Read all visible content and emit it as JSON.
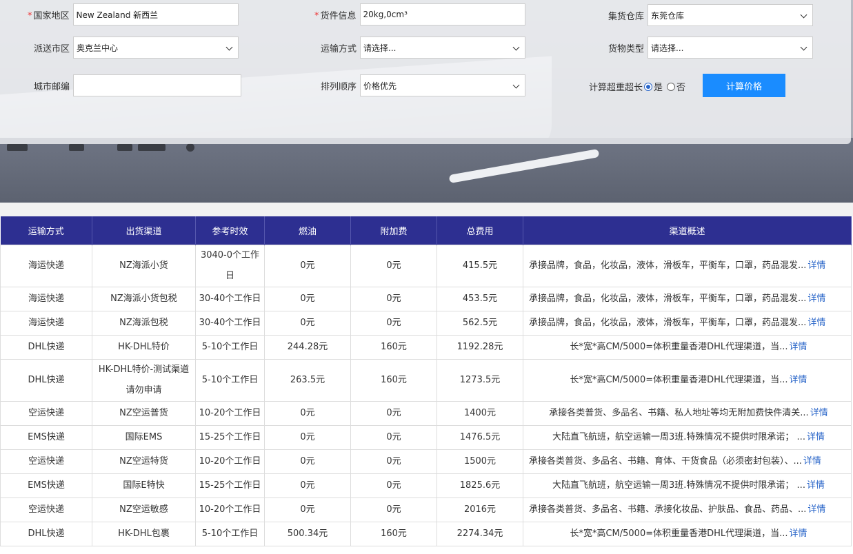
{
  "form": {
    "country": {
      "label": "国家地区",
      "value": "New Zealand 新西兰"
    },
    "cargo": {
      "label": "货件信息",
      "value": "20kg,0cm³"
    },
    "warehouse": {
      "label": "集货仓库",
      "value": "东莞仓库"
    },
    "district": {
      "label": "派送市区",
      "value": "奥克兰中心"
    },
    "shipping_method": {
      "label": "运输方式",
      "value": "请选择..."
    },
    "goods_type": {
      "label": "货物类型",
      "value": "请选择..."
    },
    "postcode": {
      "label": "城市邮编",
      "value": ""
    },
    "sort_order": {
      "label": "排列顺序",
      "value": "价格优先"
    },
    "overweight": {
      "label": "计算超重超长",
      "yes": "是",
      "no": "否",
      "selected": "是"
    },
    "calc_button": "计算价格"
  },
  "table": {
    "headers": [
      "运输方式",
      "出货渠道",
      "参考时效",
      "燃油",
      "附加费",
      "总费用",
      "渠道概述"
    ],
    "detail_label": "详情",
    "rows": [
      {
        "method": "海运快递",
        "channel": "NZ海派小货",
        "time": "3040-0个工作日",
        "fuel": "0元",
        "extra": "0元",
        "total": "415.5元",
        "desc": "承接品牌，食品，化妆品，液体，滑板车，平衡车，口罩，药品混发..."
      },
      {
        "method": "海运快递",
        "channel": "NZ海派小货包税",
        "time": "30-40个工作日",
        "fuel": "0元",
        "extra": "0元",
        "total": "453.5元",
        "desc": "承接品牌，食品，化妆品，液体，滑板车，平衡车，口罩，药品混发..."
      },
      {
        "method": "海运快递",
        "channel": "NZ海派包税",
        "time": "30-40个工作日",
        "fuel": "0元",
        "extra": "0元",
        "total": "562.5元",
        "desc": "承接品牌，食品，化妆品，液体，滑板车，平衡车，口罩，药品混发..."
      },
      {
        "method": "DHL快递",
        "channel": "HK-DHL特价",
        "time": "5-10个工作日",
        "fuel": "244.28元",
        "extra": "160元",
        "total": "1192.28元",
        "desc": "长*宽*高CM/5000=体积重量香港DHL代理渠道，当..."
      },
      {
        "method": "DHL快递",
        "channel": "HK-DHL特价-测试渠道请勿申请",
        "time": "5-10个工作日",
        "fuel": "263.5元",
        "extra": "160元",
        "total": "1273.5元",
        "desc": "长*宽*高CM/5000=体积重量香港DHL代理渠道，当..."
      },
      {
        "method": "空运快递",
        "channel": "NZ空运普货",
        "time": "10-20个工作日",
        "fuel": "0元",
        "extra": "0元",
        "total": "1400元",
        "desc": "承接各类普货、多品名、书籍、私人地址等均无附加费快件清关..."
      },
      {
        "method": "EMS快递",
        "channel": "国际EMS",
        "time": "15-25个工作日",
        "fuel": "0元",
        "extra": "0元",
        "total": "1476.5元",
        "desc": "大陆直飞航班，航空运输一周3班.特殊情况不提供时限承诺； ..."
      },
      {
        "method": "空运快递",
        "channel": "NZ空运特货",
        "time": "10-20个工作日",
        "fuel": "0元",
        "extra": "0元",
        "total": "1500元",
        "desc": "承接各类普货、多品名、书籍、育体、干货食品（必须密封包装）、..."
      },
      {
        "method": "EMS快递",
        "channel": "国际E特快",
        "time": "15-25个工作日",
        "fuel": "0元",
        "extra": "0元",
        "total": "1825.6元",
        "desc": "大陆直飞航班，航空运输一周3班.特殊情况不提供时限承诺； ..."
      },
      {
        "method": "空运快递",
        "channel": "NZ空运敏感",
        "time": "10-20个工作日",
        "fuel": "0元",
        "extra": "0元",
        "total": "2016元",
        "desc": "承接各类普货、多品名、书籍、承接化妆品、护肤品、食品、药品、..."
      },
      {
        "method": "DHL快递",
        "channel": "HK-DHL包裹",
        "time": "5-10个工作日",
        "fuel": "500.34元",
        "extra": "160元",
        "total": "2274.34元",
        "desc": "长*宽*高CM/5000=体积重量香港DHL代理渠道，当..."
      }
    ]
  }
}
